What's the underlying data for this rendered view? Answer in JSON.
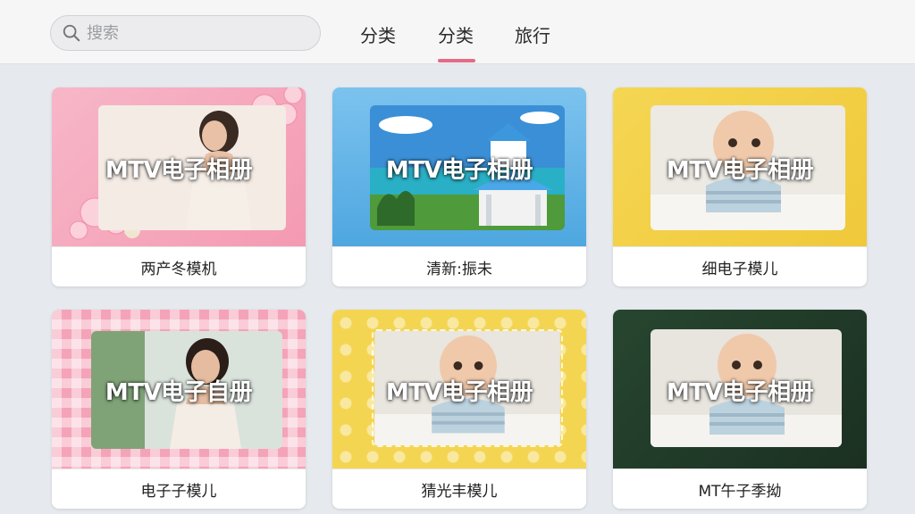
{
  "search": {
    "placeholder": "搜索"
  },
  "tabs": [
    {
      "label": "分类"
    },
    {
      "label": "分类",
      "active": true
    },
    {
      "label": "旅行"
    }
  ],
  "cards": [
    {
      "overlay": "MTV电子相册",
      "caption": "两产冬模机",
      "theme": "pink-floral"
    },
    {
      "overlay": "MTV电子相册",
      "caption": "清新:振未",
      "theme": "blue-travel"
    },
    {
      "overlay": "MTV电子相册",
      "caption": "细电子模儿",
      "theme": "yellow-baby"
    },
    {
      "overlay": "MTV电子自册",
      "caption": "电子子模儿",
      "theme": "pink-check"
    },
    {
      "overlay": "MTV电子相册",
      "caption": "猜光丰模儿",
      "theme": "yellow-dots-baby"
    },
    {
      "overlay": "MTV电子相册",
      "caption": "MT午子季拗",
      "theme": "dark-green-baby"
    }
  ],
  "colors": {
    "accent": "#e46b84",
    "topbar_bg": "#f6f6f7",
    "page_bg": "#e6e9ed"
  }
}
